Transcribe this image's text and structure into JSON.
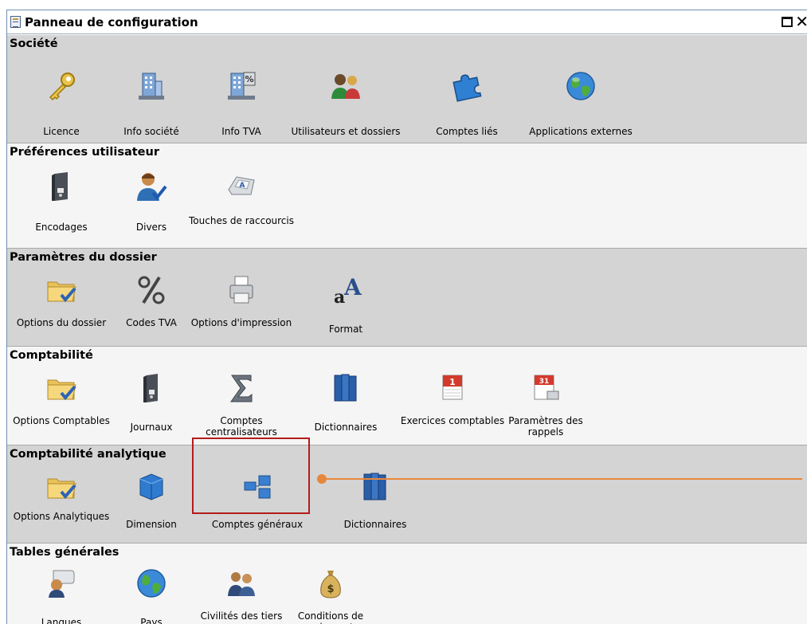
{
  "window": {
    "title": "Panneau de configuration"
  },
  "sections": [
    {
      "title": "Société",
      "items": [
        {
          "label": "Licence",
          "icon": "key-icon"
        },
        {
          "label": "Info société",
          "icon": "company-building-icon"
        },
        {
          "label": "Info TVA",
          "icon": "vat-building-icon"
        },
        {
          "label": "Utilisateurs et dossiers",
          "icon": "users-icon"
        },
        {
          "label": "Comptes liés",
          "icon": "puzzle-icon"
        },
        {
          "label": "Applications externes",
          "icon": "globe-icon"
        }
      ]
    },
    {
      "title": "Préférences utilisateur",
      "items": [
        {
          "label": "Encodages",
          "icon": "binder-icon"
        },
        {
          "label": "Divers",
          "icon": "user-check-icon"
        },
        {
          "label": "Touches de raccourcis",
          "icon": "keyboard-key-icon"
        }
      ]
    },
    {
      "title": "Paramètres du dossier",
      "items": [
        {
          "label": "Options du dossier",
          "icon": "folder-check-icon"
        },
        {
          "label": "Codes TVA",
          "icon": "percent-icon"
        },
        {
          "label": "Options d'impression",
          "icon": "printer-icon"
        },
        {
          "label": "Format",
          "icon": "font-format-icon"
        }
      ]
    },
    {
      "title": "Comptabilité",
      "items": [
        {
          "label": "Options Comptables",
          "icon": "folder-check-icon"
        },
        {
          "label": "Journaux",
          "icon": "binder-icon"
        },
        {
          "label": "Comptes centralisateurs",
          "icon": "sigma-icon"
        },
        {
          "label": "Dictionnaires",
          "icon": "books-icon"
        },
        {
          "label": "Exercices comptables",
          "icon": "calendar-icon"
        },
        {
          "label": "Paramètres des rappels",
          "icon": "calendar-31-icon"
        }
      ]
    },
    {
      "title": "Comptabilité analytique",
      "items": [
        {
          "label": "Options Analytiques",
          "icon": "folder-check-icon"
        },
        {
          "label": "Dimension",
          "icon": "cube-icon"
        },
        {
          "label": "Comptes généraux",
          "icon": "account-tree-icon"
        },
        {
          "label": "Dictionnaires",
          "icon": "books-icon"
        }
      ]
    },
    {
      "title": "Tables générales",
      "items": [
        {
          "label": "Langues",
          "icon": "speech-user-icon"
        },
        {
          "label": "Pays",
          "icon": "globe-icon"
        },
        {
          "label": "Civilités des tiers",
          "icon": "people-icon"
        },
        {
          "label": "Conditions de paiement",
          "icon": "money-bag-icon"
        }
      ]
    }
  ]
}
